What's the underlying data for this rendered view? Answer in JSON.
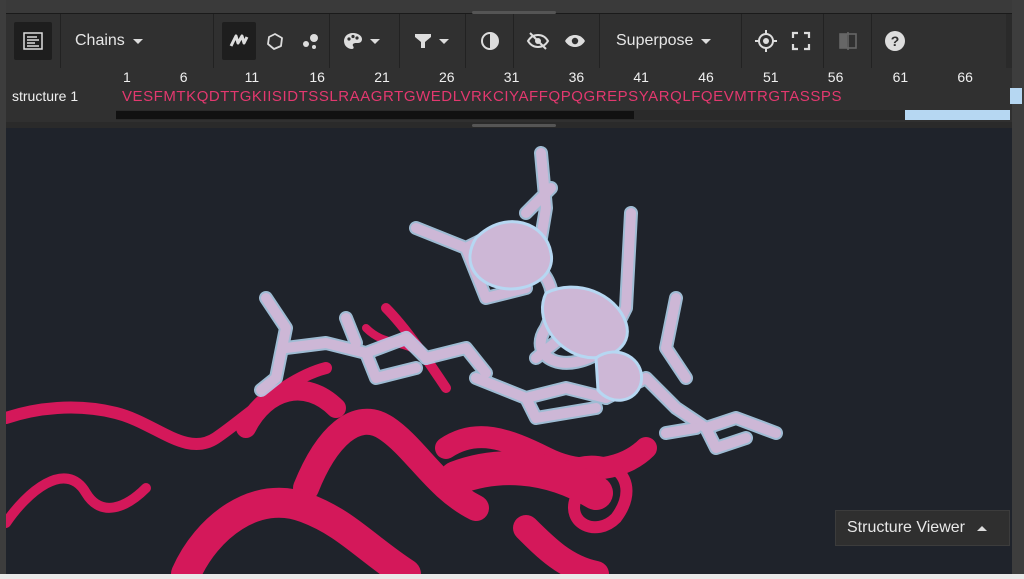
{
  "toolbar": {
    "chains_label": "Chains",
    "superpose_label": "Superpose"
  },
  "sequence": {
    "row_label": "structure 1",
    "residues": "VESFMTKQDTTGKIISIDTSSLRAAGRTGWEDLVRKCIYAFFQPQGREPSYARQLFQEVMTRGTASSPS",
    "ticks": [
      "1",
      "6",
      "11",
      "16",
      "21",
      "26",
      "31",
      "36",
      "41",
      "46",
      "51",
      "56",
      "61",
      "66"
    ]
  },
  "viewer": {
    "toggle_label": "Structure Viewer",
    "colors": {
      "background": "#1f232b",
      "chain_ribbon": "#d4185a",
      "ligand": "#cdb7d6",
      "ligand_glow": "#b6d7f2"
    }
  },
  "icons": {
    "sequence_panel": "sequence-panel-icon",
    "cartoon": "cartoon-icon",
    "surface": "surface-icon",
    "balls": "ball-and-stick-icon",
    "palette": "palette-icon",
    "filter": "filter-icon",
    "contrast": "contrast-icon",
    "hide": "eye-off-icon",
    "show": "eye-icon",
    "focus": "crosshair-icon",
    "fullscreen": "fullscreen-icon",
    "split": "split-view-icon",
    "help": "help-icon"
  }
}
